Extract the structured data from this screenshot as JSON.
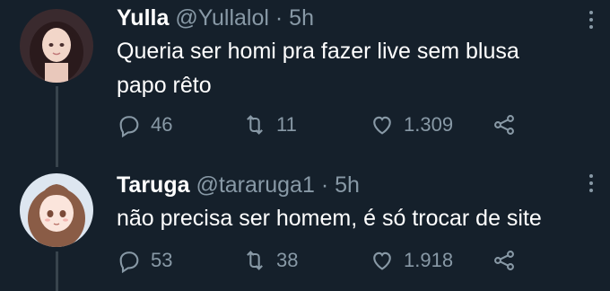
{
  "tweets": [
    {
      "name": "Yulla",
      "handle": "@Yullalol",
      "dot": "·",
      "time": "5h",
      "lines": [
        "Queria ser homi pra fazer live sem blusa",
        "papo rêto"
      ],
      "replies": "46",
      "retweets": "11",
      "likes": "1.309"
    },
    {
      "name": "Taruga",
      "handle": "@tararuga1",
      "dot": "·",
      "time": "5h",
      "lines": [
        "não precisa ser homem, é só trocar de site"
      ],
      "replies": "53",
      "retweets": "38",
      "likes": "1.918"
    }
  ],
  "colors": {
    "background": "#15202b",
    "text": "#ffffff",
    "muted": "#8899a6",
    "thread_line": "#38444d"
  },
  "icons": [
    "reply-icon",
    "retweet-icon",
    "like-icon",
    "share-icon",
    "more-icon"
  ]
}
